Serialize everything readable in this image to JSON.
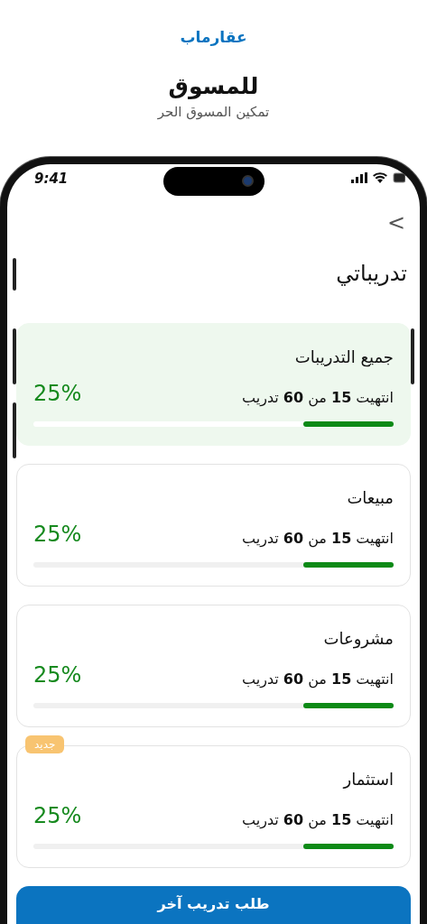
{
  "brand": "عقارماب",
  "headline": "للمسوق",
  "tagline": "تمكين المسوق الحر",
  "status_bar": {
    "time": "9:41"
  },
  "screen": {
    "back": ">",
    "title": "تدريباتي"
  },
  "trainings": [
    {
      "name": "جميع التدريبات",
      "progress_text": "انتهيت **15** من **60** تدريب",
      "percent": "25%",
      "level": 0.25,
      "selected": true
    },
    {
      "name": "مبيعات",
      "progress_text": "انتهيت **15** من **60** تدريب",
      "percent": "25%",
      "level": 0.25,
      "selected": false
    },
    {
      "name": "مشروعات",
      "progress_text": "انتهيت **15** من **60** تدريب",
      "percent": "25%",
      "level": 0.25,
      "selected": false
    },
    {
      "name": "استثمار",
      "progress_text": "انتهيت **15** من **60** تدريب",
      "percent": "25%",
      "level": 0.25,
      "selected": false,
      "badge": "جديد"
    }
  ],
  "action_button": "طلب تدريب آخر"
}
